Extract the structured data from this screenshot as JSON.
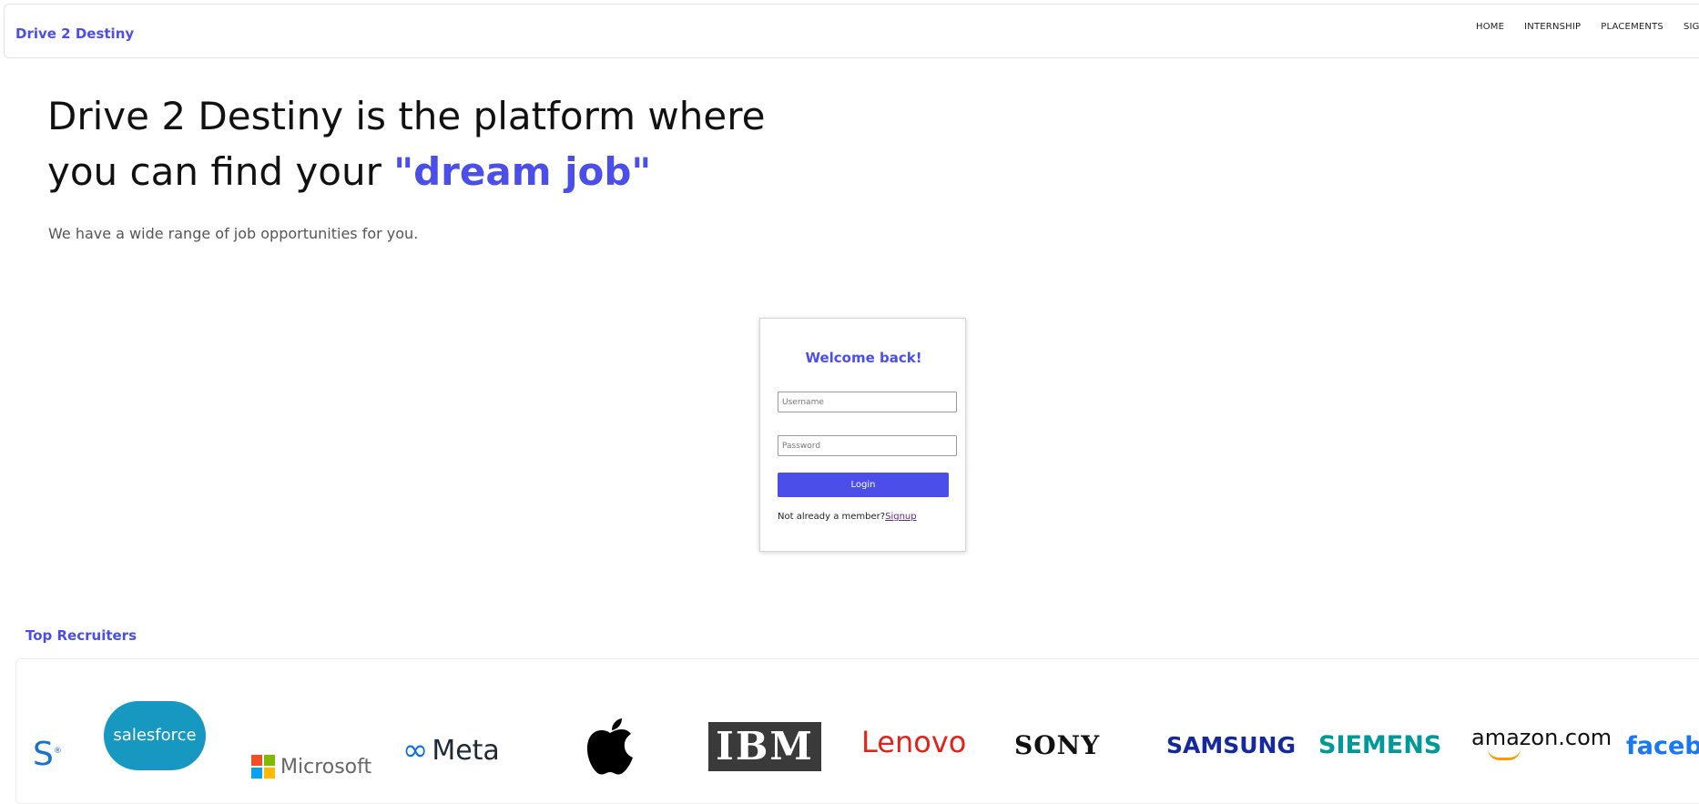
{
  "header": {
    "brand": "Drive 2 Destiny",
    "nav": [
      "HOME",
      "INTERNSHIP",
      "PLACEMENTS",
      "SIGNUP"
    ]
  },
  "hero": {
    "line1": "Drive 2 Destiny is the platform where",
    "line2_prefix": "you can find your ",
    "highlight": "\"dream job\"",
    "subtitle": "We have a wide range of job opportunities for you."
  },
  "login": {
    "title": "Welcome back!",
    "username_placeholder": "Username",
    "password_placeholder": "Password",
    "button": "Login",
    "member_text": "Not already a member?",
    "signup_link": "Signup"
  },
  "recruiters": {
    "title": "Top Recruiters",
    "logos": [
      "S",
      "salesforce",
      "Microsoft",
      "Meta",
      "Apple",
      "IBM",
      "Lenovo",
      "SONY",
      "SAMSUNG",
      "SIEMENS",
      "amazon.com",
      "faceb"
    ],
    "colors": {
      "accent": "#4b4ee8",
      "salesforce": "#1798c1",
      "meta": "#0a6fe6",
      "lenovo": "#e2231a",
      "samsung": "#1428a0",
      "siemens": "#009999",
      "amazon": "#ff9900",
      "facebook": "#1877f2"
    }
  }
}
